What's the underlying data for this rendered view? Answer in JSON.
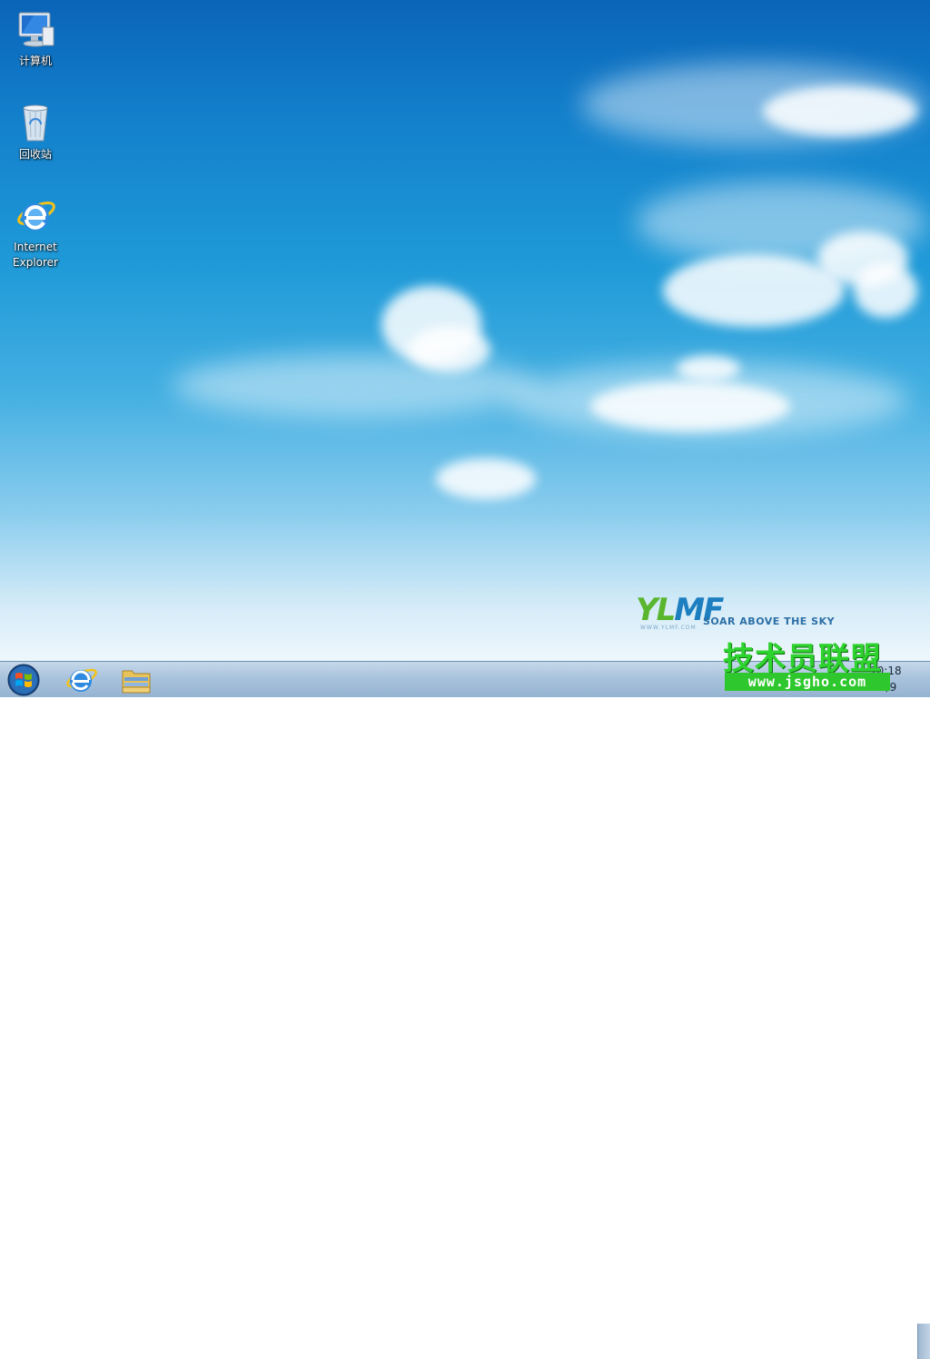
{
  "desktop": {
    "icons": [
      {
        "name": "computer",
        "label": "计算机",
        "icon": "computer-icon"
      },
      {
        "name": "recycle-bin",
        "label": "回收站",
        "icon": "recycle-bin-icon"
      },
      {
        "name": "internet-explorer",
        "label": "Internet\nExplorer",
        "icon": "internet-explorer-icon"
      }
    ],
    "wallpaper": {
      "brand": {
        "y": "Y",
        "l": "L",
        "mf": "MF"
      },
      "url": "WWW.YLMF.COM",
      "slogan": "SOAR ABOVE THE SKY",
      "colors": {
        "sky_top": "#0a64b8",
        "sky_bottom": "#eef7fc",
        "brand_green": "#5bb62f",
        "brand_blue": "#1e7fc0"
      }
    }
  },
  "taskbar": {
    "start": {
      "icon": "windows-start-icon"
    },
    "pinned": [
      {
        "name": "internet-explorer",
        "icon": "internet-explorer-icon"
      },
      {
        "name": "windows-explorer",
        "icon": "folder-icon"
      }
    ],
    "clock": {
      "time": "10:18",
      "date": "1/9"
    },
    "tray_icons": [
      "flag-icon",
      "network-icon",
      "volume-icon"
    ]
  },
  "overlay_watermark": {
    "title": "技术员联盟",
    "url": "www.jsgho.com",
    "color": "#2fd32f"
  }
}
